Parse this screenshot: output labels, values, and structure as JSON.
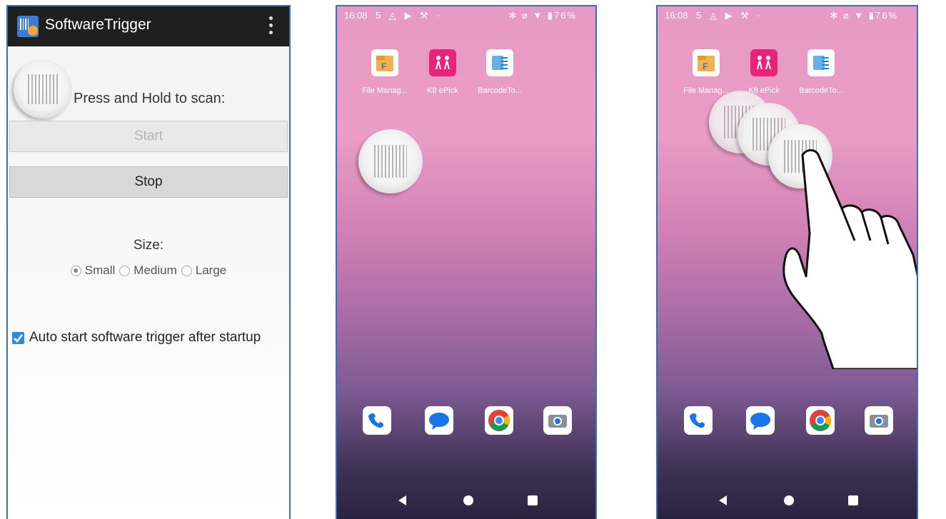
{
  "app": {
    "title": "SoftwareTrigger",
    "hold_label": "Press and Hold to scan:",
    "start_label": "Start",
    "stop_label": "Stop",
    "size_label": "Size:",
    "size_options": [
      "Small",
      "Medium",
      "Large"
    ],
    "size_selected": "Small",
    "auto_start_label": "Auto start software trigger after startup",
    "auto_start_checked": true
  },
  "phone": {
    "time": "16:08",
    "battery": "76%",
    "apps": [
      "File Manag...",
      "K8 ePick",
      "BarcodeTo..."
    ],
    "dock": [
      "phone-icon",
      "messages-icon",
      "chrome-icon",
      "camera-icon"
    ]
  },
  "colors": {
    "accent": "#3a6fb6",
    "checkbox": "#2b8be0",
    "appbar": "#1f1f1f"
  }
}
